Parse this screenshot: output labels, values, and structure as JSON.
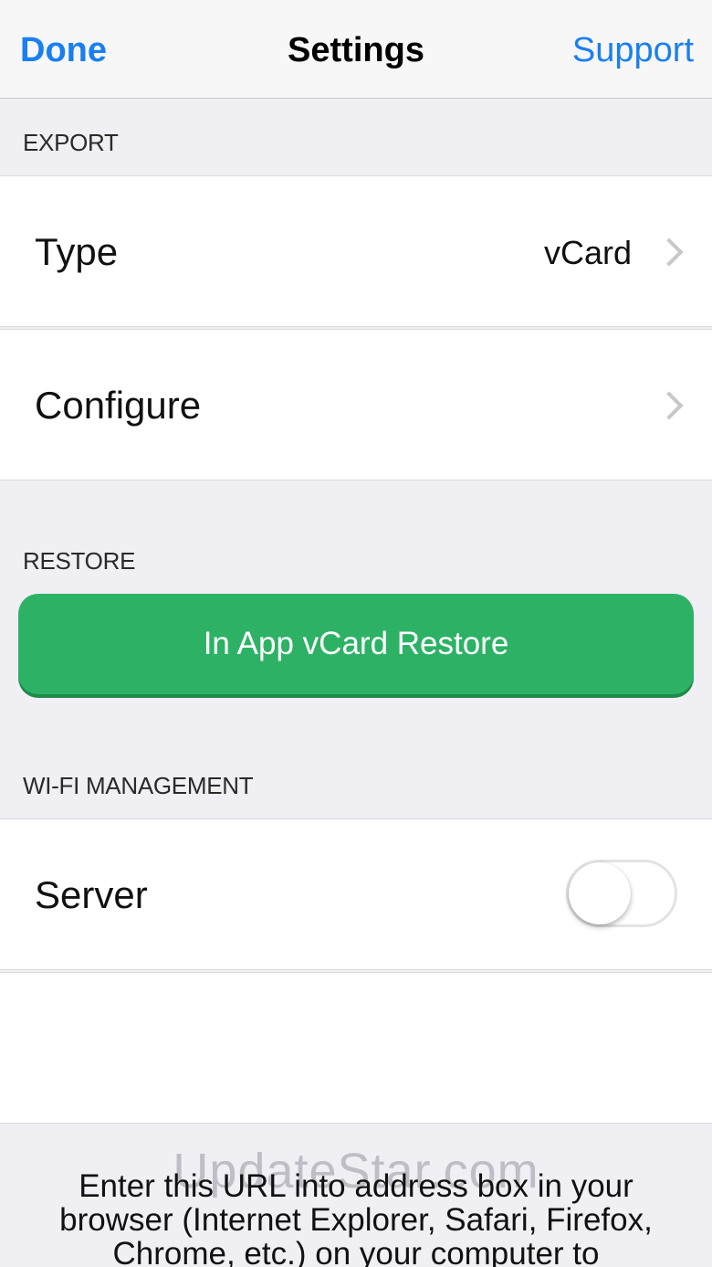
{
  "navbar": {
    "left_label": "Done",
    "title": "Settings",
    "right_label": "Support"
  },
  "sections": {
    "export": {
      "header": "EXPORT",
      "type_label": "Type",
      "type_value": "vCard",
      "configure_label": "Configure"
    },
    "restore": {
      "header": "RESTORE",
      "button_label": "In App vCard Restore"
    },
    "wifi": {
      "header": "WI-FI MANAGEMENT",
      "server_label": "Server",
      "server_on": false
    }
  },
  "instructions": {
    "text": "Enter this URL into address box in your browser (Internet Explorer, Safari, Firefox, Chrome, etc.) on your computer to"
  },
  "watermark": "UpdateStar.com",
  "colors": {
    "accent_blue": "#1a7ff0",
    "restore_green": "#2db265",
    "background": "#efeff4"
  }
}
